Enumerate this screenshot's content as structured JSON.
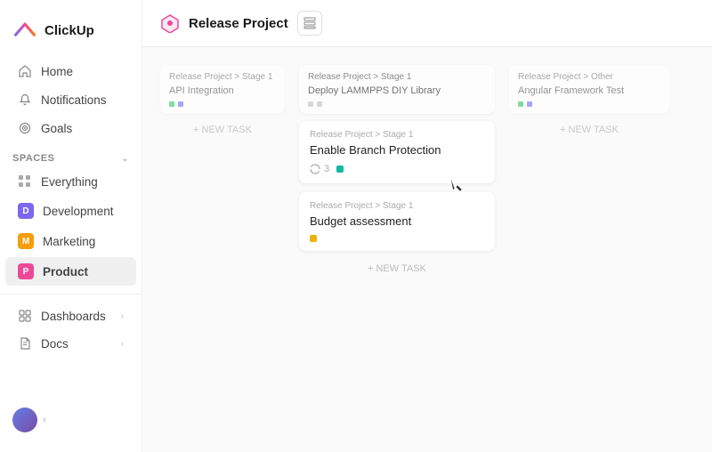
{
  "sidebar": {
    "logo": "ClickUp",
    "nav": [
      {
        "id": "home",
        "label": "Home",
        "icon": "home"
      },
      {
        "id": "notifications",
        "label": "Notifications",
        "icon": "bell"
      },
      {
        "id": "goals",
        "label": "Goals",
        "icon": "target"
      }
    ],
    "spaces_label": "Spaces",
    "spaces": [
      {
        "id": "everything",
        "label": "Everything",
        "type": "everything"
      },
      {
        "id": "development",
        "label": "Development",
        "type": "badge",
        "badge": "D",
        "badgeClass": "badge-d"
      },
      {
        "id": "marketing",
        "label": "Marketing",
        "type": "badge",
        "badge": "M",
        "badgeClass": "badge-m"
      },
      {
        "id": "product",
        "label": "Product",
        "type": "badge",
        "badge": "P",
        "badgeClass": "badge-p",
        "active": true
      }
    ],
    "bottom": [
      {
        "id": "dashboards",
        "label": "Dashboards",
        "hasArrow": true
      },
      {
        "id": "docs",
        "label": "Docs",
        "hasArrow": true
      }
    ]
  },
  "topbar": {
    "project_name": "Release Project",
    "btn_icon": "table-icon"
  },
  "board": {
    "columns": [
      {
        "id": "col1",
        "cards": [
          {
            "id": "card1",
            "path": "Release Project > Stage 1",
            "title": "API Integration",
            "tags": [
              "green",
              "blue"
            ]
          }
        ],
        "add_label": "+ NEW TASK"
      },
      {
        "id": "col2",
        "cards": [
          {
            "id": "card2",
            "path": "Release Project > Stage 1",
            "title": "Deploy LAMMPPS DIY Library",
            "tags": []
          },
          {
            "id": "card3",
            "path": "Release Project > Stage 1",
            "title": "Enable Branch Protection",
            "comments": "3",
            "tags": [
              "teal"
            ]
          },
          {
            "id": "card4",
            "path": "Release Project > Stage 1",
            "title": "Budget assessment",
            "tags": [
              "yellow"
            ]
          }
        ],
        "add_label": "+ NEW TASK"
      },
      {
        "id": "col3",
        "cards": [
          {
            "id": "card5",
            "path": "Release Project > Other",
            "title": "Angular Framework Test",
            "tags": [
              "green",
              "blue"
            ]
          }
        ],
        "add_label": "+ NEW TASK"
      }
    ]
  }
}
